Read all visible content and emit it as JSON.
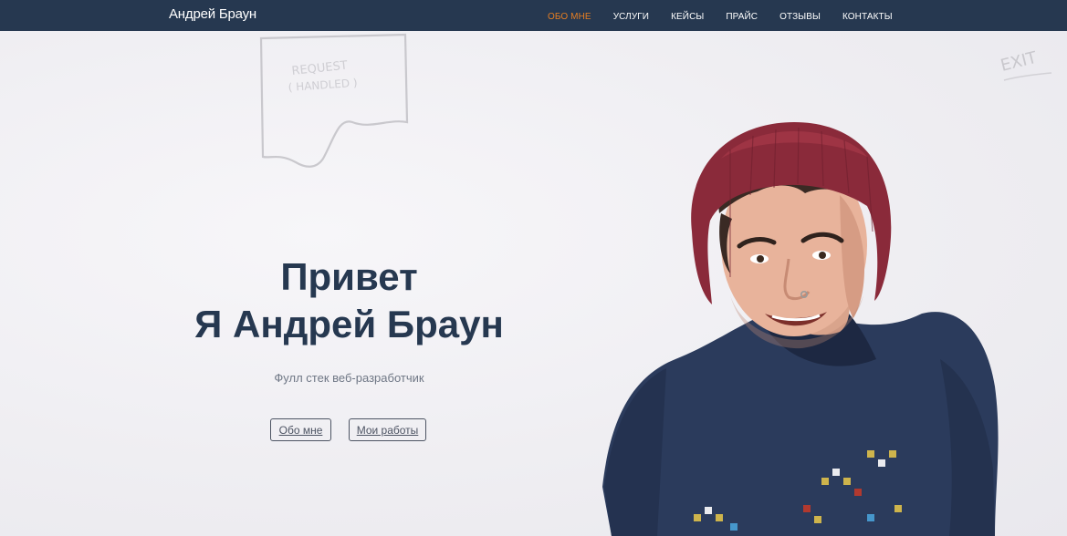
{
  "navbar": {
    "brand": "Андрей Браун",
    "items": [
      {
        "label": "ОБО МНЕ",
        "active": true
      },
      {
        "label": "УСЛУГИ",
        "active": false
      },
      {
        "label": "КЕЙСЫ",
        "active": false
      },
      {
        "label": "ПРАЙС",
        "active": false
      },
      {
        "label": "ОТЗЫВЫ",
        "active": false
      },
      {
        "label": "КОНТАКТЫ",
        "active": false
      }
    ]
  },
  "hero": {
    "title_line1": "Привет",
    "title_line2": "Я Андрей Браун",
    "subtitle": "Фулл стек веб-разработчик",
    "buttons": {
      "about": "Обо мне",
      "works": "Мои работы"
    },
    "whiteboard_note": "EXIT"
  },
  "colors": {
    "navbar_bg": "#263850",
    "active_link": "#e67e22",
    "title_text": "#263850",
    "button_border": "#4d5463"
  }
}
